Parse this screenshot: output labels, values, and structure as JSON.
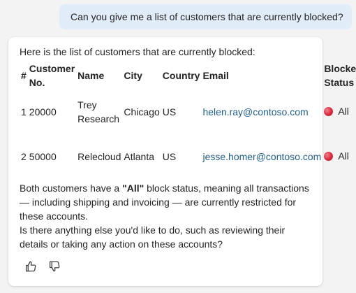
{
  "user_message": "Can you give me a list of customers that are currently blocked?",
  "assistant": {
    "intro": "Here is the list of customers that are currently blocked:",
    "table": {
      "headers": {
        "index": "#",
        "customer_no": "Customer No.",
        "name": "Name",
        "city": "City",
        "country": "Country",
        "email": "Email",
        "blocked_status": "Blocked Status"
      },
      "rows": [
        {
          "index": "1",
          "customer_no": "20000",
          "name": "Trey Research",
          "city": "Chicago",
          "country": "US",
          "email": "helen.ray@contoso.com",
          "blocked_status": "All"
        },
        {
          "index": "2",
          "customer_no": "50000",
          "name": "Relecloud",
          "city": "Atlanta",
          "country": "US",
          "email": "jesse.homer@contoso.com",
          "blocked_status": "All"
        }
      ]
    },
    "summary": {
      "before_bold": "Both customers have a ",
      "bold": "\"All\"",
      "after_bold": " block status, meaning all transactions — including shipping and invoicing — are currently restricted for these accounts.",
      "followup": "Is there anything else you'd like to do, such as reviewing their details or taking any action on these accounts?"
    },
    "actions": {
      "like_icon": "thumbs-up-icon",
      "dislike_icon": "thumbs-down-icon"
    }
  },
  "colors": {
    "user_bubble": "#e1ecf9",
    "link": "#1f5f8b",
    "blocked_dot": "#d9293d"
  }
}
